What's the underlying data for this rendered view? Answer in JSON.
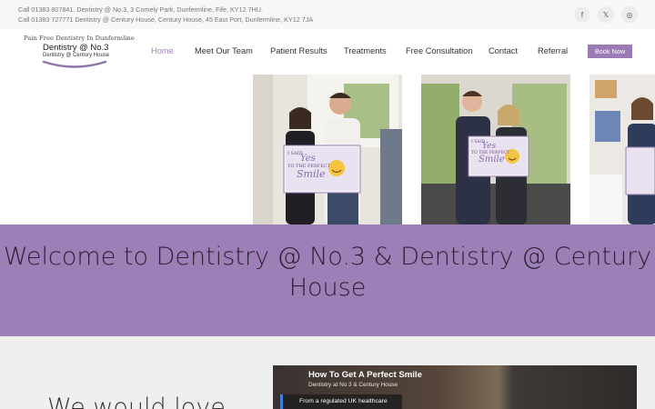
{
  "topbar": {
    "line1": "Call 01383 807841. Dentistry @ No.3, 3 Comely Park, Dunfermline, Fife, KY12 7HU.",
    "line2": "Call 01383 727771 Dentistry @ Century House, Century House, 45 East Port, Dunfermline, KY12 7JA",
    "social": [
      {
        "icon": "facebook-icon",
        "glyph": "f"
      },
      {
        "icon": "x-icon",
        "glyph": "𝕏"
      },
      {
        "icon": "instagram-icon",
        "glyph": "◎"
      }
    ]
  },
  "logo": {
    "tagline": "Pain Free Dentistry In Dunfermline",
    "name": "Dentistry @ No.3",
    "sub": "Dentistry @ Century House"
  },
  "nav": {
    "items": [
      "Home",
      "Meet Our Team",
      "Patient Results",
      "Treatments",
      "Free Consultation",
      "Contact",
      "Referral"
    ],
    "active": "Home",
    "book_label": "Book Now"
  },
  "photos": {
    "sign": {
      "line1": "I SAID",
      "line2": "Yes",
      "line3": "TO THE PERFECT",
      "line4": "Smile"
    }
  },
  "banner": {
    "heading": "Welcome to Dentistry @ No.3 & Dentistry @ Century House"
  },
  "lower": {
    "heading": "We would love",
    "video": {
      "title": "How To Get A Perfect Smile",
      "channel": "Dentistry at No 3 & Century House",
      "chip": "From a regulated UK healthcare"
    }
  },
  "colors": {
    "accent": "#9b7fb6",
    "button": "#9b7bb5",
    "nav_active": "#a183c0",
    "banner_text": "#2b2236"
  }
}
